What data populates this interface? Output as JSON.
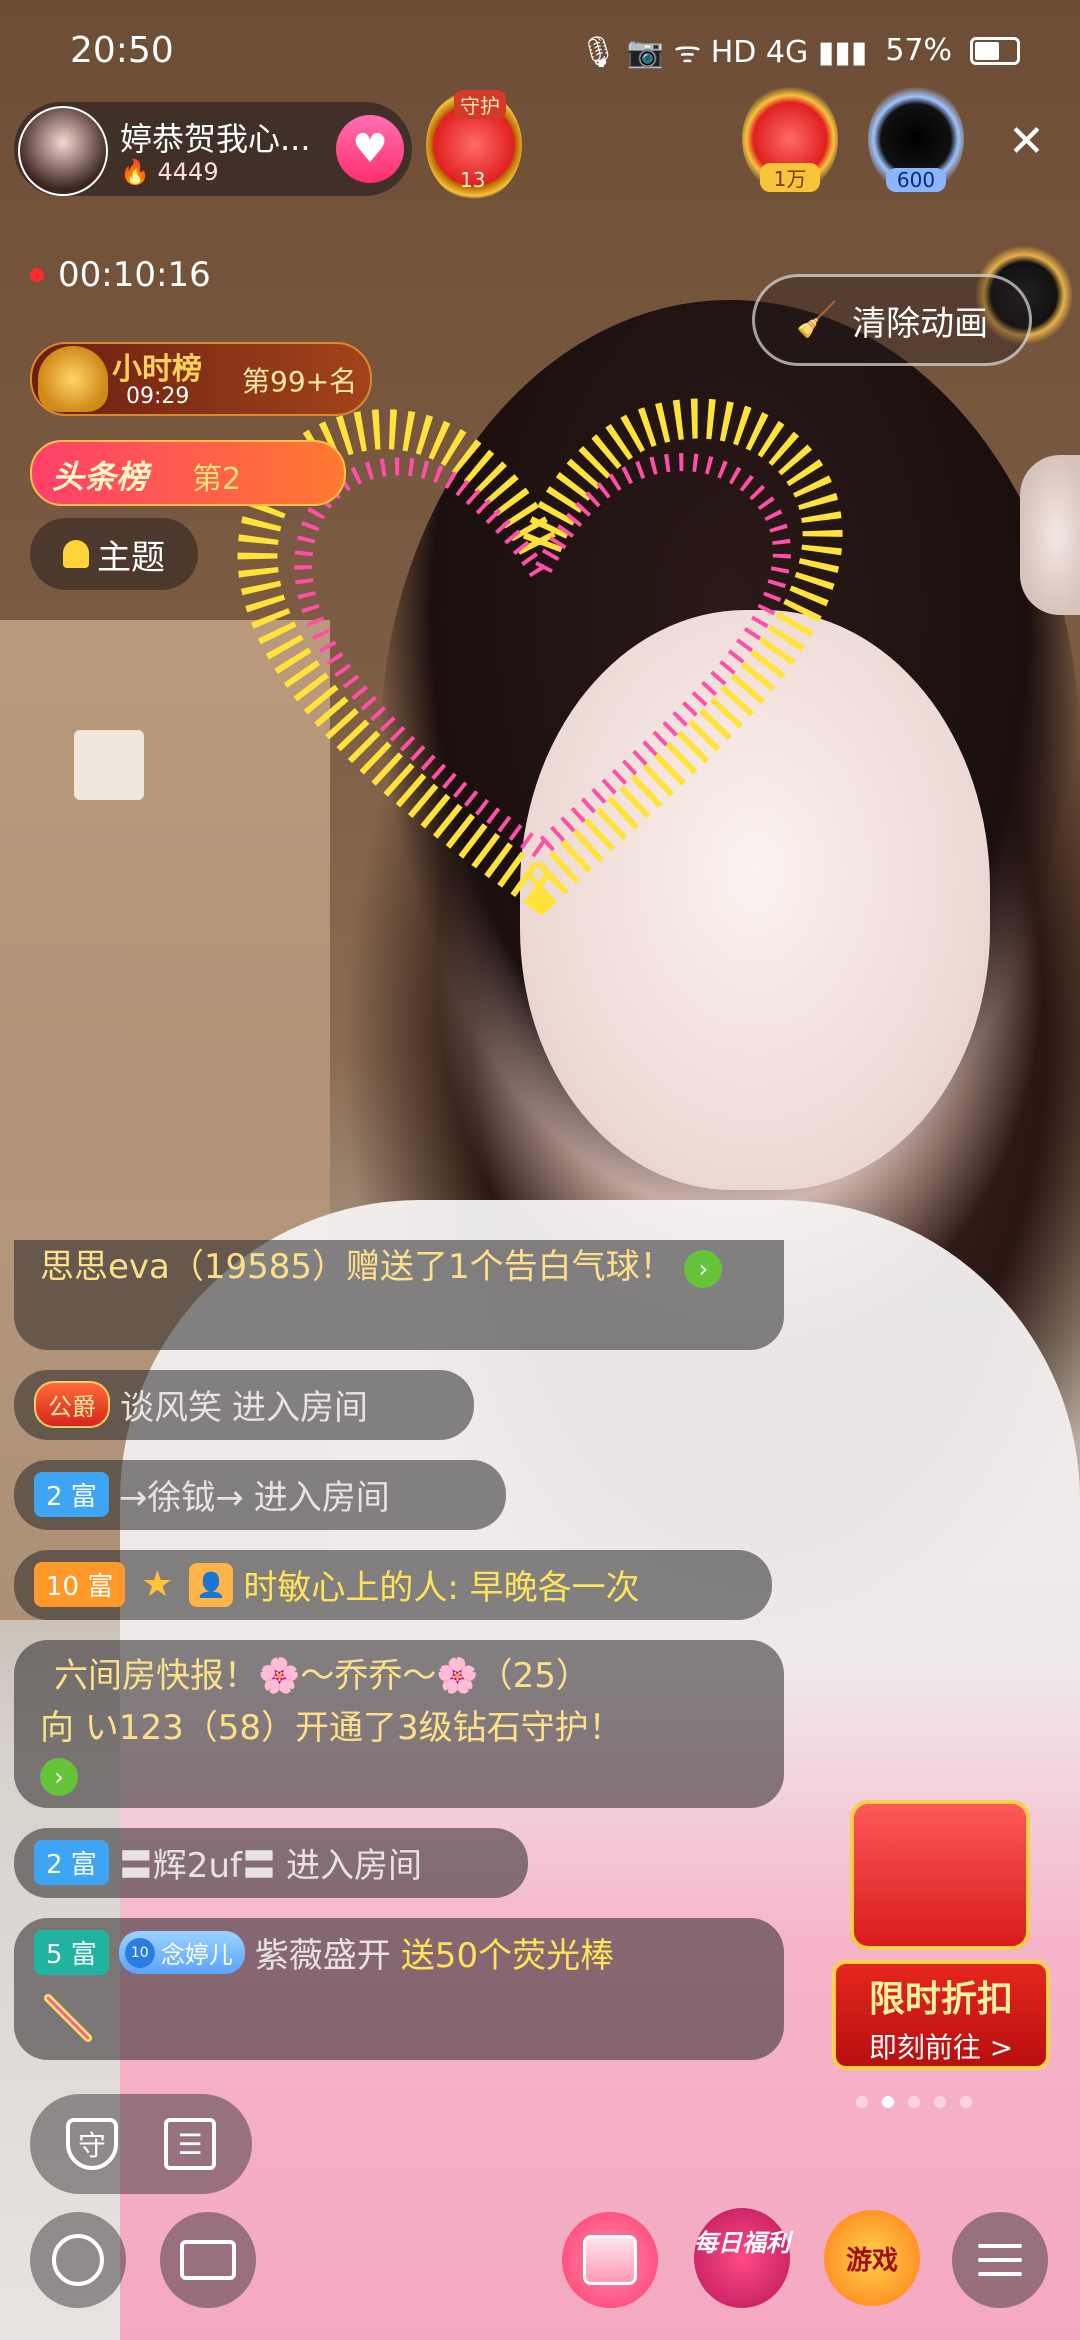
{
  "status_bar": {
    "time": "20:50",
    "icons": "🎙 📷 ᯤ HD 4G ▮▮▮",
    "battery": "57%"
  },
  "host": {
    "name": "婷恭贺我心...",
    "heat": "4449"
  },
  "guard_badge": {
    "label": "守护",
    "count": "13"
  },
  "ranking": {
    "first": "1万",
    "second": "600"
  },
  "live_timer": "00:10:16",
  "clear_animation_label": "清除动画",
  "hour_rank": {
    "title": "小时榜",
    "time": "09:29",
    "position": "第99+名"
  },
  "headline_rank": {
    "title": "头条榜",
    "position": "第2"
  },
  "topic_label": "主题",
  "chat": [
    {
      "text": "思思eva（19585）赠送了1个告白气球！"
    },
    {
      "tag": "公爵",
      "name": "谈风笑",
      "action": "进入房间"
    },
    {
      "level": "2 富",
      "name": "→徐钺→",
      "action": "进入房间"
    },
    {
      "level": "10 富",
      "name": "时敏心上的人: 早晚各一次"
    },
    {
      "line1": "六间房快报！🌸～乔乔～🌸（25）",
      "line2": "向 い123（58）开通了3级钻石守护！"
    },
    {
      "level": "2 富",
      "name": "〓辉2uf〓",
      "action": "进入房间"
    },
    {
      "level": "5 富",
      "fan_level": "10",
      "fan_tag": "念婷儿",
      "name": "紫薇盛开",
      "action": "送50个荧光棒"
    }
  ],
  "promo": {
    "title": "限时折扣",
    "cta": "即刻前往 >"
  },
  "bottom": {
    "daily": "每日福利",
    "game": "游戏"
  },
  "icons": {
    "close": "close-icon",
    "guard": "shield-icon",
    "task": "clipboard-icon",
    "chat": "chat-icon",
    "mail": "mail-icon",
    "gift": "gift-icon",
    "menu": "menu-icon"
  }
}
